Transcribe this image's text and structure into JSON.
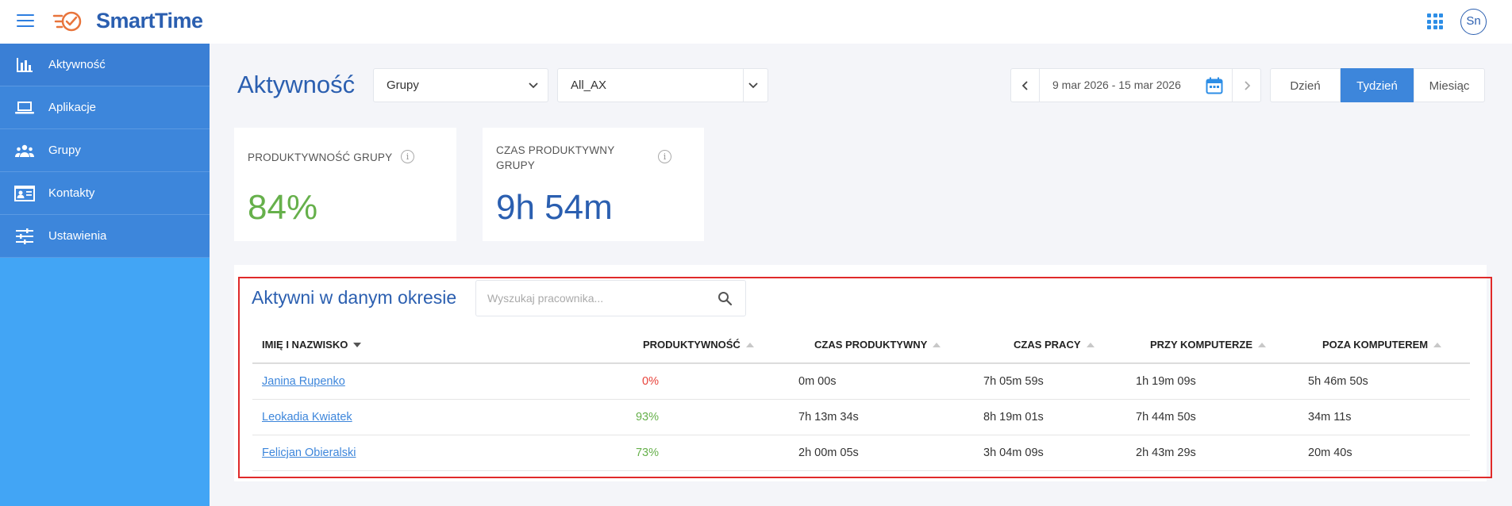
{
  "app": {
    "name": "SmartTime",
    "user_initials": "Sn"
  },
  "colors": {
    "brand": "#2b5fb0",
    "accent": "#3d86db",
    "sidebar": "#42a5f5",
    "good": "#66b04b",
    "bad": "#e8433b",
    "highlight": "#e02a2a"
  },
  "sidebar": {
    "items": [
      {
        "label": "Aktywność",
        "icon": "bar-chart-icon",
        "active": true
      },
      {
        "label": "Aplikacje",
        "icon": "laptop-icon",
        "active": false
      },
      {
        "label": "Grupy",
        "icon": "people-icon",
        "active": false
      },
      {
        "label": "Kontakty",
        "icon": "contact-card-icon",
        "active": false
      },
      {
        "label": "Ustawienia",
        "icon": "sliders-icon",
        "active": false
      }
    ]
  },
  "header": {
    "title": "Aktywność",
    "group_select": "Grupy",
    "group_value": "All_AX",
    "date_range": "9 mar 2026 - 15 mar 2026",
    "periods": [
      "Dzień",
      "Tydzień",
      "Miesiąc"
    ],
    "active_period": "Tydzień"
  },
  "cards": {
    "productivity": {
      "label": "Produktywność grupy",
      "value": "84%"
    },
    "productive_time": {
      "label": "Czas produktywny grupy",
      "value": "9h 54m"
    }
  },
  "active": {
    "title": "Aktywni w danym okresie",
    "search_placeholder": "Wyszukaj pracownika...",
    "columns": [
      "Imię i nazwisko",
      "Produktywność",
      "Czas produktywny",
      "Czas pracy",
      "Przy komputerze",
      "Poza komputerem"
    ],
    "rows": [
      {
        "name": "Janina Rupenko",
        "productivity": "0%",
        "productive_time": "0m 00s",
        "work_time": "7h 05m 59s",
        "at_pc": "1h 19m 09s",
        "off_pc": "5h 46m 50s",
        "status": "bad"
      },
      {
        "name": "Leokadia Kwiatek",
        "productivity": "93%",
        "productive_time": "7h 13m 34s",
        "work_time": "8h 19m 01s",
        "at_pc": "7h 44m 50s",
        "off_pc": "34m 11s",
        "status": "good"
      },
      {
        "name": "Felicjan Obieralski",
        "productivity": "73%",
        "productive_time": "2h 00m 05s",
        "work_time": "3h 04m 09s",
        "at_pc": "2h 43m 29s",
        "off_pc": "20m 40s",
        "status": "good"
      }
    ]
  }
}
